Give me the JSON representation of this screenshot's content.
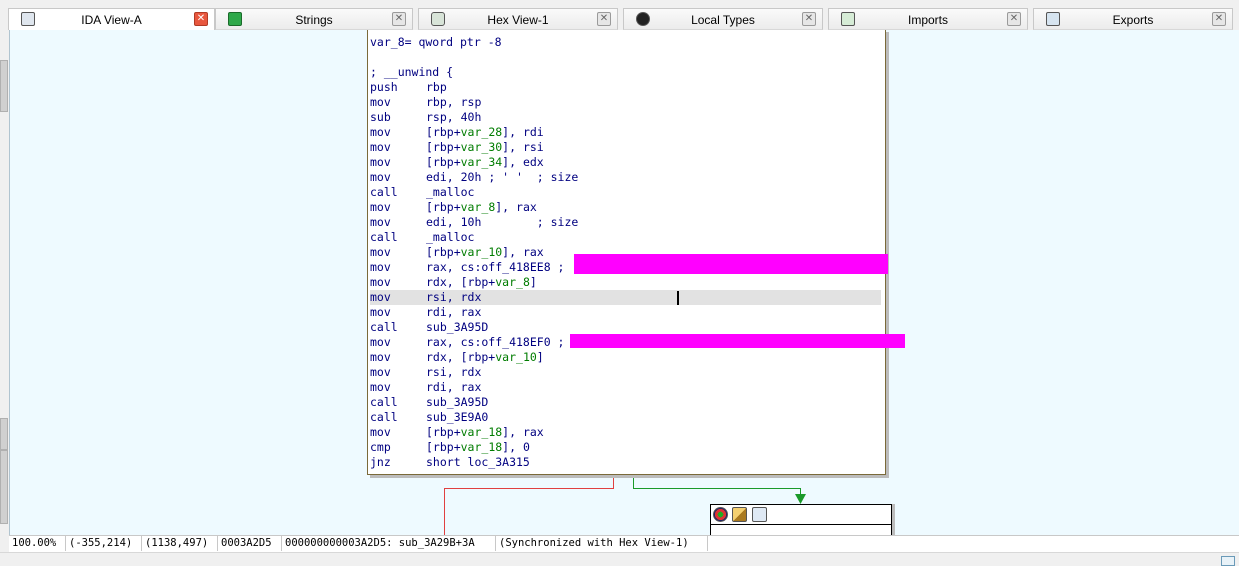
{
  "tabs": [
    {
      "label": "IDA View-A",
      "active": true,
      "icon": "ida-view-icon",
      "close_style": "red"
    },
    {
      "label": "Strings",
      "active": false,
      "icon": "strings-icon",
      "close_style": "grey"
    },
    {
      "label": "Hex View-1",
      "active": false,
      "icon": "hex-view-icon",
      "close_style": "grey"
    },
    {
      "label": "Local Types",
      "active": false,
      "icon": "local-types-icon",
      "close_style": "grey"
    },
    {
      "label": "Imports",
      "active": false,
      "icon": "imports-icon",
      "close_style": "grey"
    },
    {
      "label": "Exports",
      "active": false,
      "icon": "exports-icon",
      "close_style": "grey"
    }
  ],
  "close_glyph": "✕",
  "code": {
    "lines": [
      {
        "full": "var_8= qword ptr -8"
      },
      {
        "full": ""
      },
      {
        "full": "; __unwind {"
      },
      {
        "mn": "push",
        "op": "rbp"
      },
      {
        "mn": "mov",
        "op": "rbp, rsp"
      },
      {
        "mn": "sub",
        "op": "rsp, 40h"
      },
      {
        "mn": "mov",
        "pre": "[rbp+",
        "var": "var_28",
        "post": "], rdi"
      },
      {
        "mn": "mov",
        "pre": "[rbp+",
        "var": "var_30",
        "post": "], rsi"
      },
      {
        "mn": "mov",
        "pre": "[rbp+",
        "var": "var_34",
        "post": "], edx"
      },
      {
        "mn": "mov",
        "op": "edi, 20h",
        "cm": " ; ' '  ; size"
      },
      {
        "mn": "call",
        "op": "_malloc"
      },
      {
        "mn": "mov",
        "pre": "[rbp+",
        "var": "var_8",
        "post": "], rax"
      },
      {
        "mn": "mov",
        "op": "edi, 10h",
        "cm": "        ; size"
      },
      {
        "mn": "call",
        "op": "_malloc"
      },
      {
        "mn": "mov",
        "pre": "[rbp+",
        "var": "var_10",
        "post": "], rax"
      },
      {
        "mn": "mov",
        "op": "rax, cs:off_418EE8",
        "cm": " ;"
      },
      {
        "mn": "mov",
        "pre": "rdx, [rbp+",
        "var": "var_8",
        "post": "]"
      },
      {
        "mn": "mov",
        "op": "rsi, rdx",
        "highlight": true
      },
      {
        "mn": "mov",
        "op": "rdi, rax"
      },
      {
        "mn": "call",
        "op": "sub_3A95D"
      },
      {
        "mn": "mov",
        "op": "rax, cs:off_418EF0",
        "cm": " ;"
      },
      {
        "mn": "mov",
        "pre": "rdx, [rbp+",
        "var": "var_10",
        "post": "]"
      },
      {
        "mn": "mov",
        "op": "rsi, rdx"
      },
      {
        "mn": "mov",
        "op": "rdi, rax"
      },
      {
        "mn": "call",
        "op": "sub_3A95D"
      },
      {
        "mn": "call",
        "op": "sub_3E9A0"
      },
      {
        "mn": "mov",
        "pre": "[rbp+",
        "var": "var_18",
        "post": "], rax"
      },
      {
        "mn": "cmp",
        "pre": "[rbp+",
        "var": "var_18",
        "post": "], 0"
      },
      {
        "mn": "jnz",
        "op": "short loc_3A315"
      }
    ]
  },
  "colors": {
    "graph_bg": "#eefaff",
    "redaction": "#ff00ff",
    "edge_false": "#e04040",
    "edge_true": "#1a9a2a",
    "code_text": "#000080",
    "code_var": "#007c00"
  },
  "node2_icons": [
    "color-picker-icon",
    "rename-icon",
    "graph-view-icon"
  ],
  "status": {
    "zoom": "100.00%",
    "mouse_pos": "(-355,214)",
    "graph_pos": "(1138,497)",
    "file_offset": "0003A2D5",
    "address": "000000000003A2D5: sub_3A29B+3A",
    "sync": "(Synchronized with Hex View-1)"
  }
}
